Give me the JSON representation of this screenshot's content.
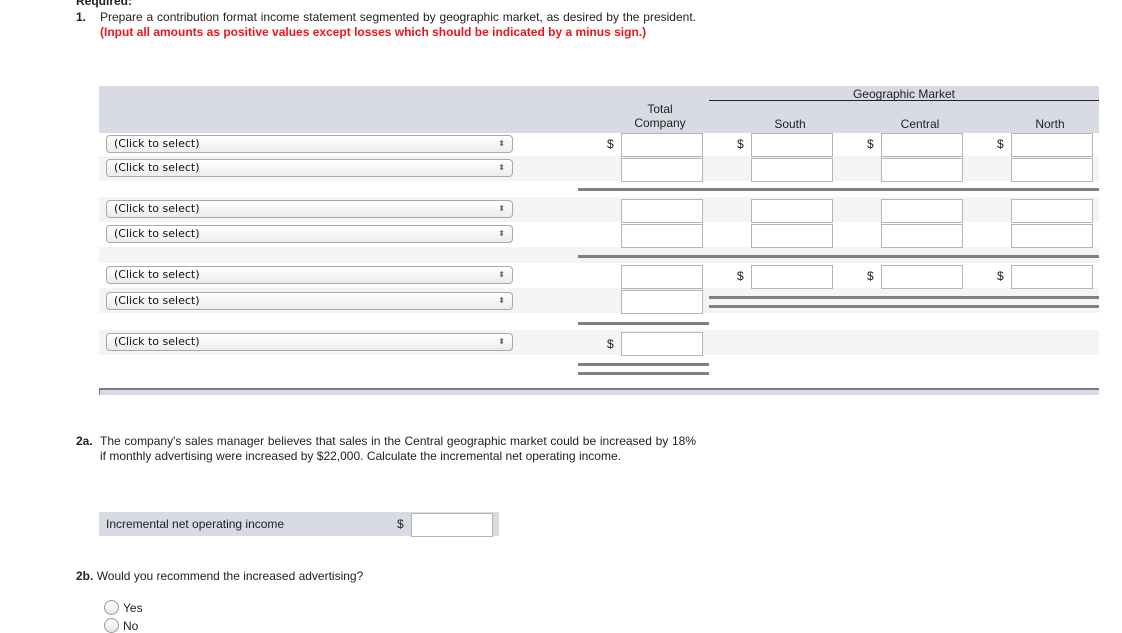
{
  "required_heading": "Required:",
  "question1": {
    "number": "1.",
    "text": "Prepare a contribution format income statement segmented by geographic market, as desired by the president.",
    "instruction": "(Input all amounts as positive values except losses which should be indicated by a minus sign.)"
  },
  "table": {
    "group_header": "Geographic Market",
    "columns": [
      "Total Company",
      "South",
      "Central",
      "North"
    ],
    "column_total_line1": "Total",
    "column_total_line2": "Company",
    "currency_symbol": "$",
    "select_placeholder": "(Click to select)",
    "select_arrow": "⬍",
    "rows": [
      {
        "select": "(Click to select)",
        "values": [
          "",
          "",
          "",
          ""
        ]
      },
      {
        "select": "(Click to select)",
        "values": [
          "",
          "",
          "",
          ""
        ]
      },
      {
        "select": "(Click to select)",
        "values": [
          "",
          "",
          "",
          ""
        ]
      },
      {
        "select": "(Click to select)",
        "values": [
          "",
          "",
          "",
          ""
        ]
      },
      {
        "select": "(Click to select)",
        "values": [
          "",
          "",
          "",
          ""
        ]
      },
      {
        "select": "(Click to select)",
        "values": [
          ""
        ]
      },
      {
        "select": "(Click to select)",
        "values": [
          ""
        ]
      }
    ]
  },
  "question2a": {
    "number": "2a.",
    "text": "The company's sales manager believes that sales in the Central geographic market could be increased by 18% if monthly advertising were increased by $22,000. Calculate the incremental net operating income.",
    "field_label": "Incremental net operating income",
    "currency_symbol": "$",
    "value": ""
  },
  "question2b": {
    "number": "2b.",
    "text": "Would you recommend the increased advertising?",
    "options": [
      "Yes",
      "No"
    ]
  }
}
